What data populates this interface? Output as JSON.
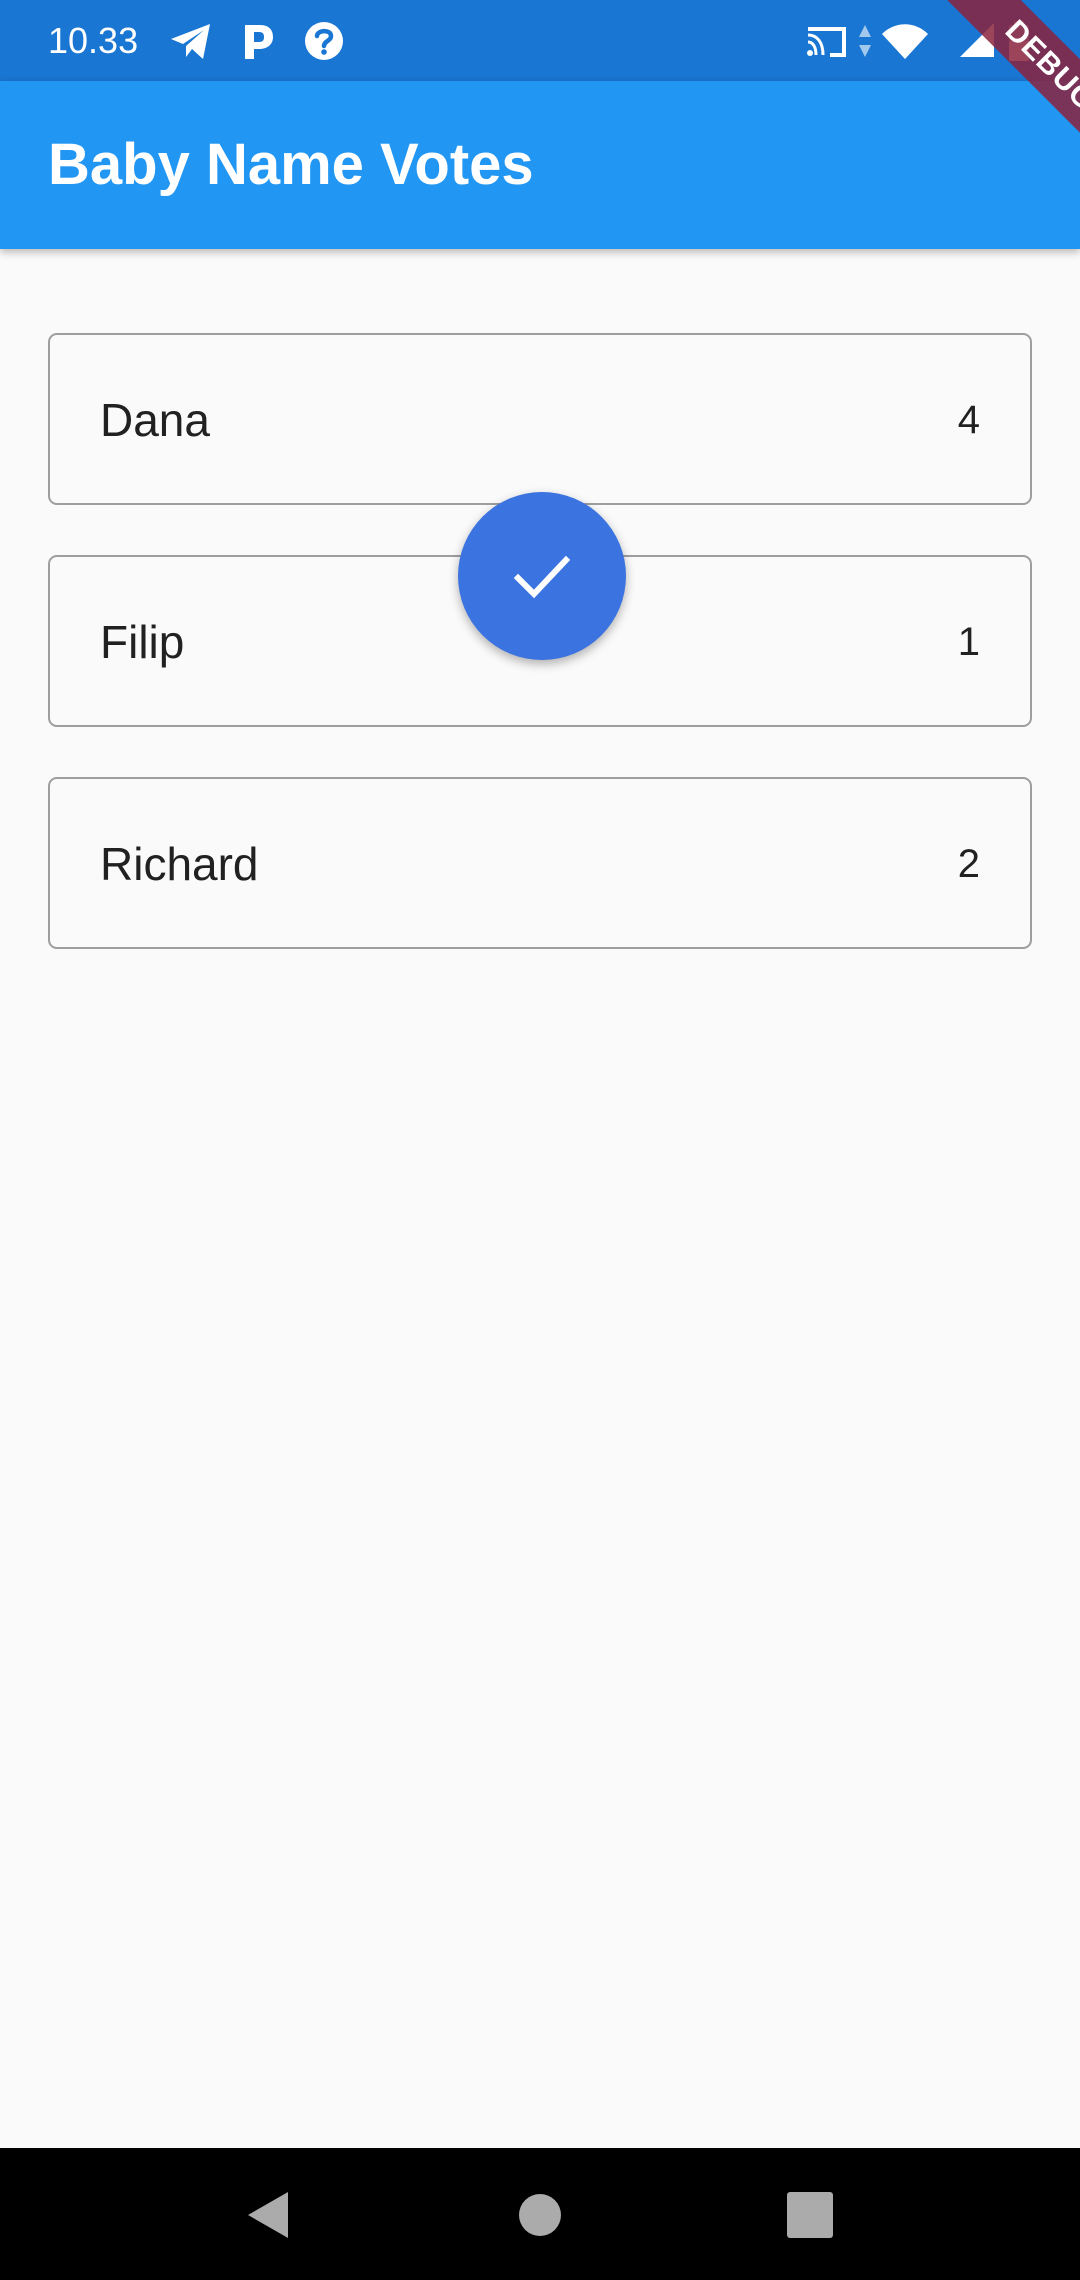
{
  "status_bar": {
    "time": "10.33",
    "left_icons": [
      "telegram-icon",
      "parking-icon",
      "help-icon"
    ],
    "right_icons": [
      "cast-icon",
      "data-arrows-icon",
      "wifi-icon",
      "signal-icon",
      "battery-icon"
    ],
    "color": "#1976d2"
  },
  "app_bar": {
    "title": "Baby Name Votes",
    "color": "#2196f3"
  },
  "debug_banner": {
    "label": "DEBUG"
  },
  "votes": [
    {
      "name": "Dana",
      "count": "4"
    },
    {
      "name": "Filip",
      "count": "1"
    },
    {
      "name": "Richard",
      "count": "2"
    }
  ],
  "fab": {
    "icon": "check-icon",
    "color": "#3b73e0"
  },
  "nav_bar": {
    "buttons": [
      "back-icon",
      "home-icon",
      "recents-icon"
    ]
  }
}
